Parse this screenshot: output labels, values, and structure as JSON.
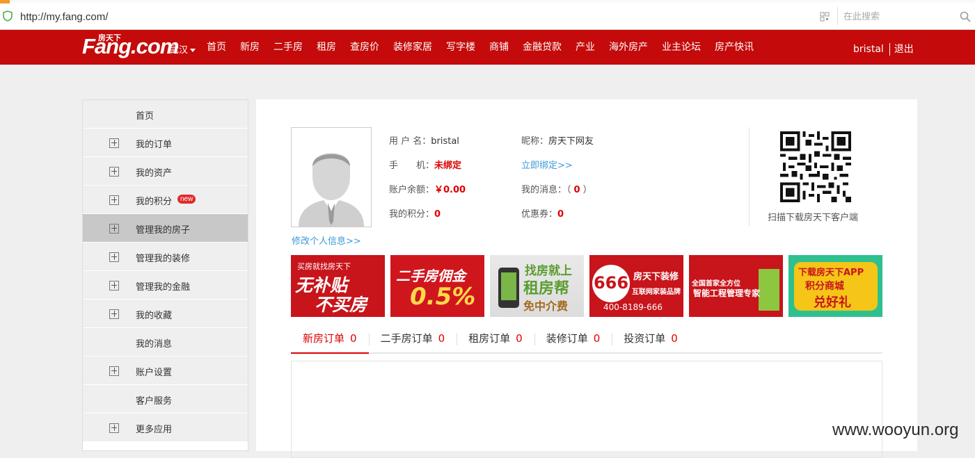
{
  "browser": {
    "url": "http://my.fang.com/",
    "search_placeholder": "在此搜索"
  },
  "header": {
    "logo_text": "Fang.com",
    "logo_small": "房天下",
    "city": "武汉",
    "nav": [
      "首页",
      "新房",
      "二手房",
      "租房",
      "查房价",
      "装修家居",
      "写字楼",
      "商铺",
      "金融贷款",
      "产业",
      "海外房产",
      "业主论坛",
      "房产快讯"
    ],
    "username": "bristal",
    "logout": "退出"
  },
  "sidebar": {
    "items": [
      {
        "label": "首页",
        "expandable": false
      },
      {
        "label": "我的订单",
        "expandable": true
      },
      {
        "label": "我的资产",
        "expandable": true
      },
      {
        "label": "我的积分",
        "expandable": true,
        "badge": "new"
      },
      {
        "label": "管理我的房子",
        "expandable": true,
        "active": true
      },
      {
        "label": "管理我的装修",
        "expandable": true
      },
      {
        "label": "管理我的金融",
        "expandable": true
      },
      {
        "label": "我的收藏",
        "expandable": true
      },
      {
        "label": "我的消息",
        "expandable": false
      },
      {
        "label": "账户设置",
        "expandable": true
      },
      {
        "label": "客户服务",
        "expandable": false
      },
      {
        "label": "更多应用",
        "expandable": true
      }
    ]
  },
  "profile": {
    "username_label": "用 户 名：",
    "username_value": "bristal",
    "nickname_label": "昵称：",
    "nickname_value": "房天下网友",
    "phone_label": "手　　机：",
    "phone_value": "未绑定",
    "bind_link": "立即绑定>>",
    "balance_label": "账户余额：",
    "balance_value": "￥0.00",
    "messages_label": "我的消息：（",
    "messages_value": "0",
    "messages_close": "）",
    "points_label": "我的积分：",
    "points_value": "0",
    "coupon_label": "优惠券：",
    "coupon_value": "0",
    "edit_link": "修改个人信息>>",
    "qr_caption": "扫描下载房天下客户端"
  },
  "banners": {
    "b1": {
      "line1": "买房就找房天下",
      "line2": "无补贴",
      "line3": "不买房"
    },
    "b2": {
      "line1": "二手房佣金",
      "line2": "0.5%"
    },
    "b3": {
      "line1": "找房就上",
      "line2": "租房帮",
      "line3": "免中介费"
    },
    "b4": {
      "num": "666",
      "line1": "房天下装修",
      "line2": "互联网家装品牌",
      "line3": "400-8189-666"
    },
    "b5": {
      "line1": "全国首家全方位",
      "line2": "智能工程管理专家"
    },
    "b6": {
      "line1": "下载房天下APP",
      "line2": "积分商城",
      "line3": "兑好礼"
    }
  },
  "order_tabs": [
    {
      "label": "新房订单",
      "count": "0"
    },
    {
      "label": "二手房订单",
      "count": "0"
    },
    {
      "label": "租房订单",
      "count": "0"
    },
    {
      "label": "装修订单",
      "count": "0"
    },
    {
      "label": "投资订单",
      "count": "0"
    }
  ],
  "watermark": "www.wooyun.org",
  "colors": {
    "brand_red": "#c40a0a",
    "link_blue": "#3a9ad9",
    "value_red": "#dd0000"
  }
}
